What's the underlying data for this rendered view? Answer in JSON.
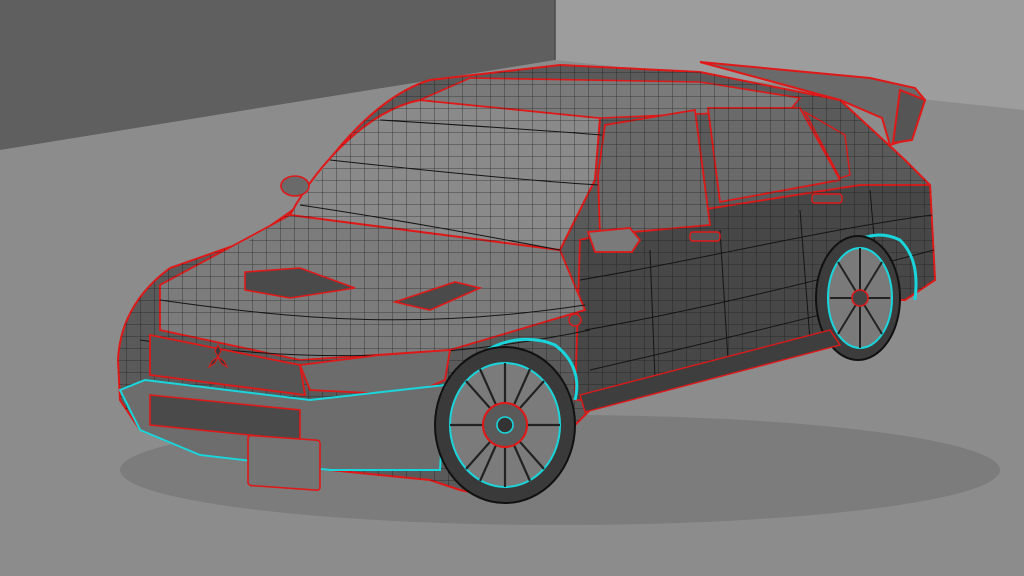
{
  "viewport": {
    "label": "",
    "colors": {
      "wall_left": "#5f5f5f",
      "wall_right": "#9d9d9d",
      "floor": "#8c8c8c",
      "body_dark": "#4b4b4b",
      "body_mid": "#6e6e6e",
      "body_light": "#9a9a9a",
      "glass": "#8a8a8a",
      "wire": "#111111",
      "edge_red": "#e01818",
      "edge_cyan": "#19d6dc"
    }
  },
  "model": {
    "subject": "wireframe-sedan-3d-model",
    "badge_icon": "three-diamond-emblem-icon"
  }
}
